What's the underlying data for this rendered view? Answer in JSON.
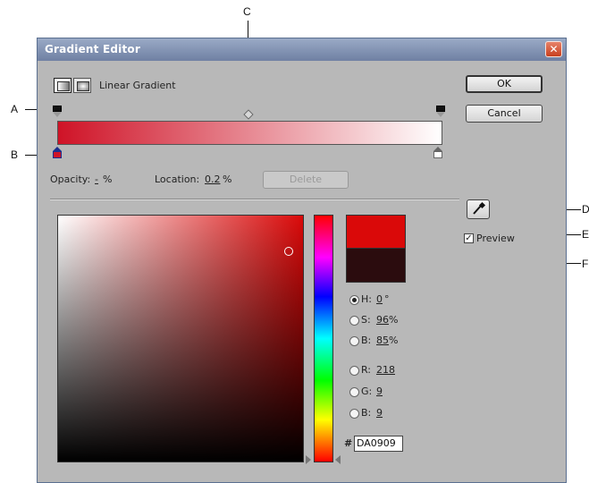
{
  "callouts": {
    "a": "A",
    "b": "B",
    "c": "C",
    "d": "D",
    "e": "E",
    "f": "F"
  },
  "window": {
    "title": "Gradient Editor",
    "close_glyph": "✕"
  },
  "gradient_type": {
    "label": "Linear Gradient"
  },
  "buttons": {
    "ok": "OK",
    "cancel": "Cancel",
    "delete": "Delete"
  },
  "stop_controls": {
    "opacity_label": "Opacity:",
    "opacity_value": "-",
    "opacity_unit": "%",
    "location_label": "Location:",
    "location_value": "0.2",
    "location_unit": "%"
  },
  "preview": {
    "label": "Preview",
    "checked": true
  },
  "colors": {
    "current": "#DA0909",
    "gradient_start": "#cf1327",
    "gradient_end": "#ffffff",
    "previous_swatch": "#2b0c0e"
  },
  "color_fields": {
    "h_label": "H:",
    "h_value": "0",
    "h_unit": "°",
    "s_label": "S:",
    "s_value": "96",
    "s_unit": "%",
    "b_label": "B:",
    "b_value": "85",
    "b_unit": "%",
    "r_label": "R:",
    "r_value": "218",
    "g_label": "G:",
    "g_value": "9",
    "b2_label": "B:",
    "b2_value": "9",
    "hex_prefix": "#",
    "hex_value": "DA0909",
    "selected_mode": "H"
  },
  "icons": {
    "eyedropper": "eyedropper-icon",
    "close": "close-icon",
    "linear_gradient": "linear-gradient-icon",
    "radial_gradient": "radial-gradient-icon"
  }
}
